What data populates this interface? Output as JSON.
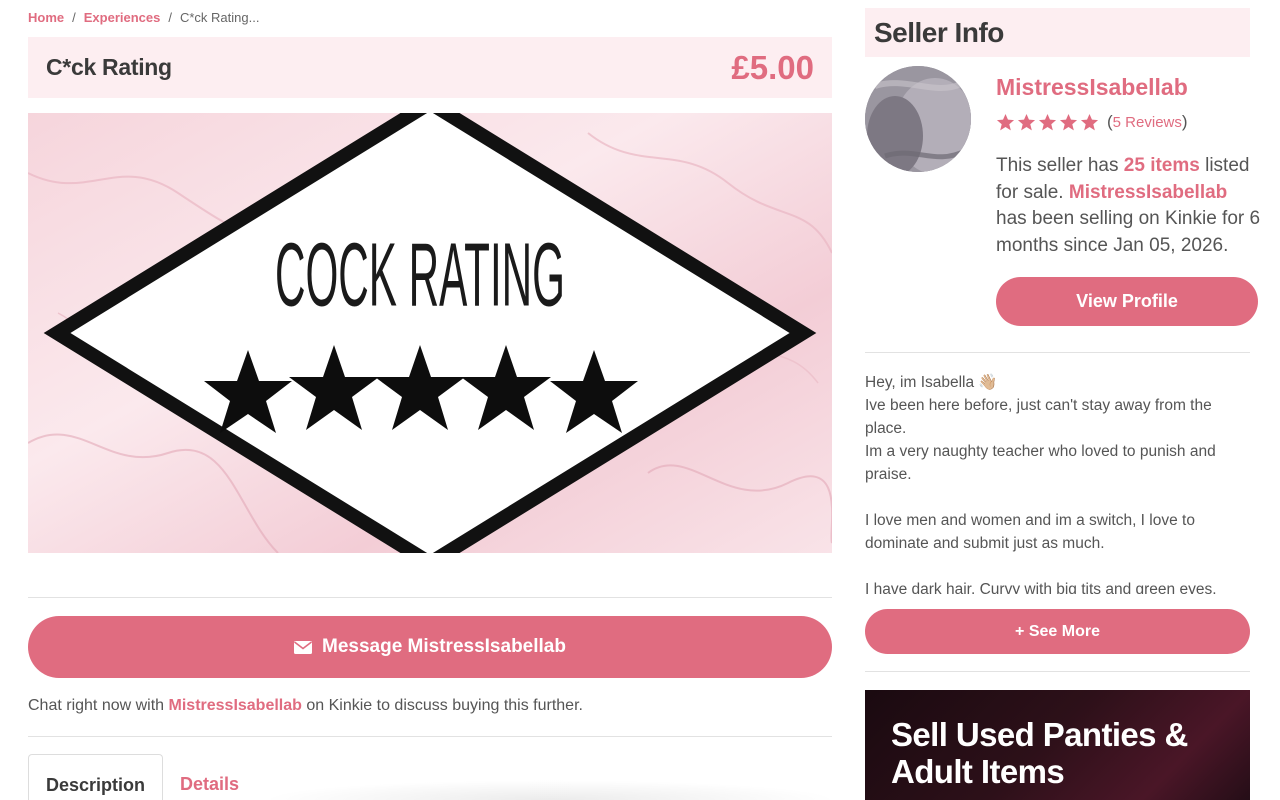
{
  "breadcrumb": {
    "home": "Home",
    "category": "Experiences",
    "current": "C*ck Rating..."
  },
  "product": {
    "title": "C*ck Rating",
    "price": "£5.00",
    "image_text": "COCK RATING"
  },
  "message": {
    "button_label": "Message MistressIsabellab",
    "chat_prefix": "Chat right now with",
    "chat_seller": "MistressIsabellab",
    "chat_suffix": "on Kinkie to discuss buying this further."
  },
  "tabs": [
    {
      "label": "Description",
      "active": true
    },
    {
      "label": "Details",
      "active": false
    }
  ],
  "seller": {
    "heading": "Seller Info",
    "name": "MistressIsabellab",
    "rating": 5,
    "reviews_label": "5 Reviews",
    "desc_1": "This seller has",
    "items_count": "25 items",
    "desc_2": "listed for sale.",
    "desc_name": "MistressIsabellab",
    "desc_3": "has been selling on Kinkie for 6 months since Jan 05, 2026.",
    "view_profile_label": "View Profile",
    "bio": "Hey, im Isabella 👋🏼\nIve been here before, just can't stay away from the place.\nIm a very naughty teacher who loved to punish and praise.\n\nI love men and women and im a switch, I love to dominate and submit just as much.\n\nI have dark hair. Curvy with big tits and green eyes.",
    "see_more_label": "+ See More"
  },
  "promo": {
    "title": "Sell Used Panties &\nAdult Items"
  },
  "colors": {
    "accent": "#e06c80",
    "tint": "#fdeef1"
  }
}
